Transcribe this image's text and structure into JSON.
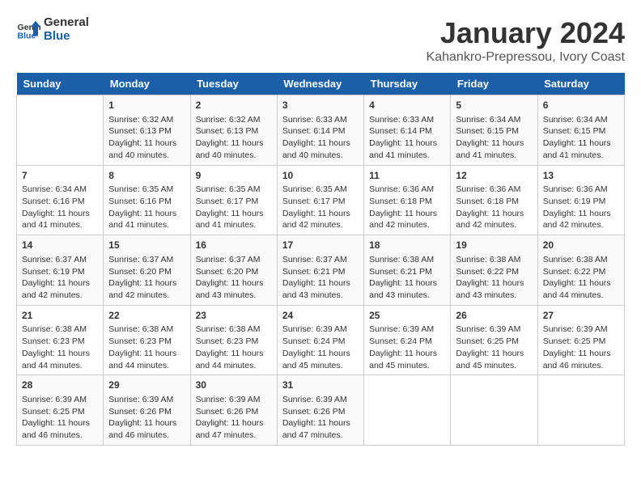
{
  "header": {
    "logo_line1": "General",
    "logo_line2": "Blue",
    "main_title": "January 2024",
    "subtitle": "Kahankro-Prepressou, Ivory Coast"
  },
  "days_of_week": [
    "Sunday",
    "Monday",
    "Tuesday",
    "Wednesday",
    "Thursday",
    "Friday",
    "Saturday"
  ],
  "weeks": [
    [
      {
        "day": "",
        "content": ""
      },
      {
        "day": "1",
        "content": "Sunrise: 6:32 AM\nSunset: 6:13 PM\nDaylight: 11 hours and 40 minutes."
      },
      {
        "day": "2",
        "content": "Sunrise: 6:32 AM\nSunset: 6:13 PM\nDaylight: 11 hours and 40 minutes."
      },
      {
        "day": "3",
        "content": "Sunrise: 6:33 AM\nSunset: 6:14 PM\nDaylight: 11 hours and 40 minutes."
      },
      {
        "day": "4",
        "content": "Sunrise: 6:33 AM\nSunset: 6:14 PM\nDaylight: 11 hours and 41 minutes."
      },
      {
        "day": "5",
        "content": "Sunrise: 6:34 AM\nSunset: 6:15 PM\nDaylight: 11 hours and 41 minutes."
      },
      {
        "day": "6",
        "content": "Sunrise: 6:34 AM\nSunset: 6:15 PM\nDaylight: 11 hours and 41 minutes."
      }
    ],
    [
      {
        "day": "7",
        "content": "Sunrise: 6:34 AM\nSunset: 6:16 PM\nDaylight: 11 hours and 41 minutes."
      },
      {
        "day": "8",
        "content": "Sunrise: 6:35 AM\nSunset: 6:16 PM\nDaylight: 11 hours and 41 minutes."
      },
      {
        "day": "9",
        "content": "Sunrise: 6:35 AM\nSunset: 6:17 PM\nDaylight: 11 hours and 41 minutes."
      },
      {
        "day": "10",
        "content": "Sunrise: 6:35 AM\nSunset: 6:17 PM\nDaylight: 11 hours and 42 minutes."
      },
      {
        "day": "11",
        "content": "Sunrise: 6:36 AM\nSunset: 6:18 PM\nDaylight: 11 hours and 42 minutes."
      },
      {
        "day": "12",
        "content": "Sunrise: 6:36 AM\nSunset: 6:18 PM\nDaylight: 11 hours and 42 minutes."
      },
      {
        "day": "13",
        "content": "Sunrise: 6:36 AM\nSunset: 6:19 PM\nDaylight: 11 hours and 42 minutes."
      }
    ],
    [
      {
        "day": "14",
        "content": "Sunrise: 6:37 AM\nSunset: 6:19 PM\nDaylight: 11 hours and 42 minutes."
      },
      {
        "day": "15",
        "content": "Sunrise: 6:37 AM\nSunset: 6:20 PM\nDaylight: 11 hours and 42 minutes."
      },
      {
        "day": "16",
        "content": "Sunrise: 6:37 AM\nSunset: 6:20 PM\nDaylight: 11 hours and 43 minutes."
      },
      {
        "day": "17",
        "content": "Sunrise: 6:37 AM\nSunset: 6:21 PM\nDaylight: 11 hours and 43 minutes."
      },
      {
        "day": "18",
        "content": "Sunrise: 6:38 AM\nSunset: 6:21 PM\nDaylight: 11 hours and 43 minutes."
      },
      {
        "day": "19",
        "content": "Sunrise: 6:38 AM\nSunset: 6:22 PM\nDaylight: 11 hours and 43 minutes."
      },
      {
        "day": "20",
        "content": "Sunrise: 6:38 AM\nSunset: 6:22 PM\nDaylight: 11 hours and 44 minutes."
      }
    ],
    [
      {
        "day": "21",
        "content": "Sunrise: 6:38 AM\nSunset: 6:23 PM\nDaylight: 11 hours and 44 minutes."
      },
      {
        "day": "22",
        "content": "Sunrise: 6:38 AM\nSunset: 6:23 PM\nDaylight: 11 hours and 44 minutes."
      },
      {
        "day": "23",
        "content": "Sunrise: 6:38 AM\nSunset: 6:23 PM\nDaylight: 11 hours and 44 minutes."
      },
      {
        "day": "24",
        "content": "Sunrise: 6:39 AM\nSunset: 6:24 PM\nDaylight: 11 hours and 45 minutes."
      },
      {
        "day": "25",
        "content": "Sunrise: 6:39 AM\nSunset: 6:24 PM\nDaylight: 11 hours and 45 minutes."
      },
      {
        "day": "26",
        "content": "Sunrise: 6:39 AM\nSunset: 6:25 PM\nDaylight: 11 hours and 45 minutes."
      },
      {
        "day": "27",
        "content": "Sunrise: 6:39 AM\nSunset: 6:25 PM\nDaylight: 11 hours and 46 minutes."
      }
    ],
    [
      {
        "day": "28",
        "content": "Sunrise: 6:39 AM\nSunset: 6:25 PM\nDaylight: 11 hours and 46 minutes."
      },
      {
        "day": "29",
        "content": "Sunrise: 6:39 AM\nSunset: 6:26 PM\nDaylight: 11 hours and 46 minutes."
      },
      {
        "day": "30",
        "content": "Sunrise: 6:39 AM\nSunset: 6:26 PM\nDaylight: 11 hours and 47 minutes."
      },
      {
        "day": "31",
        "content": "Sunrise: 6:39 AM\nSunset: 6:26 PM\nDaylight: 11 hours and 47 minutes."
      },
      {
        "day": "",
        "content": ""
      },
      {
        "day": "",
        "content": ""
      },
      {
        "day": "",
        "content": ""
      }
    ]
  ]
}
